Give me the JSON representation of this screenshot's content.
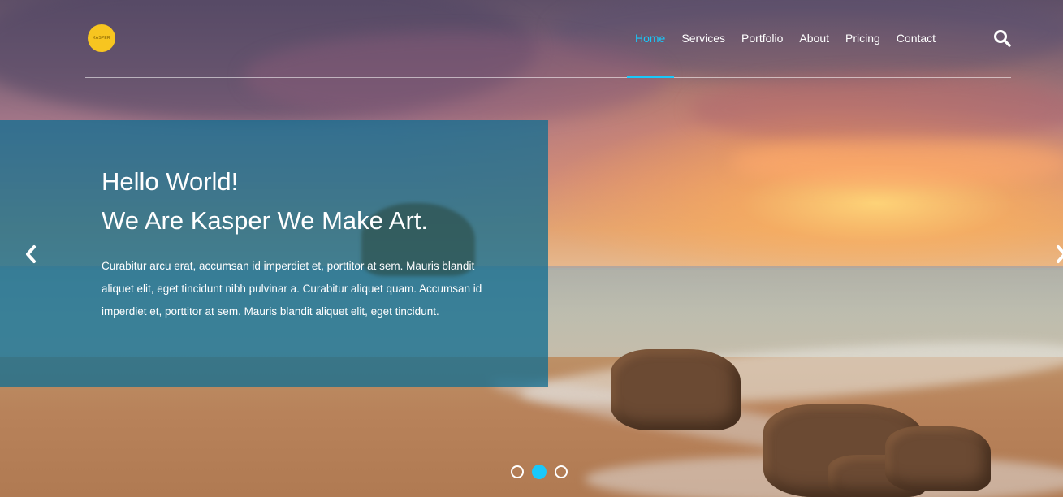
{
  "logo": {
    "text": "KASPER"
  },
  "nav": {
    "items": [
      {
        "label": "Home"
      },
      {
        "label": "Services"
      },
      {
        "label": "Portfolio"
      },
      {
        "label": "About"
      },
      {
        "label": "Pricing"
      },
      {
        "label": "Contact"
      }
    ],
    "active_index": 0
  },
  "hero": {
    "title_line1": "Hello World!",
    "title_line2": "We Are Kasper We Make Art.",
    "paragraph": "Curabitur arcu erat, accumsan id imperdiet et, porttitor at sem. Mauris blandit aliquet elit, eget tincidunt nibh pulvinar a. Curabitur aliquet quam. Accumsan id imperdiet et, porttitor at sem. Mauris blandit aliquet elit, eget tincidunt."
  },
  "slider": {
    "dot_count": 3,
    "active_dot": 1
  },
  "icons": {
    "search": "search-icon",
    "prev": "chevron-left-icon",
    "next": "chevron-right-icon"
  },
  "colors": {
    "accent": "#19c8fa",
    "panel": "#146e91",
    "logo": "#f7c520"
  }
}
